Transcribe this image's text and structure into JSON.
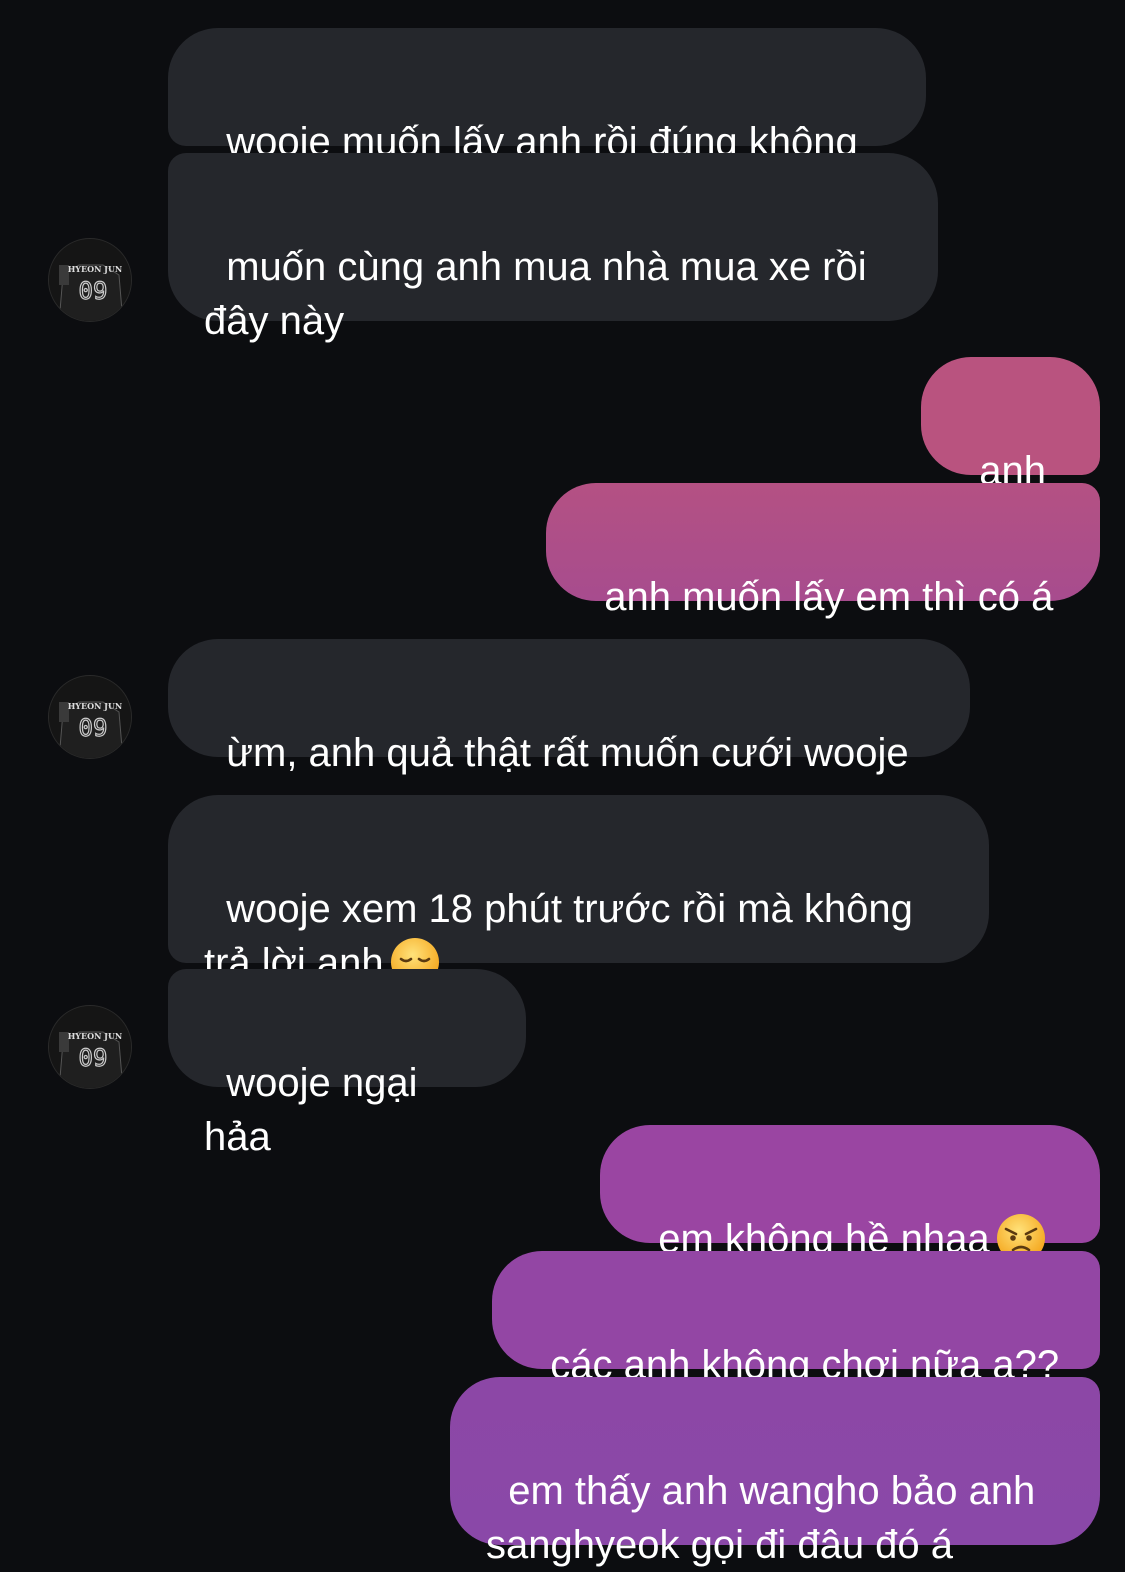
{
  "conversation": {
    "messages": [
      {
        "text": "wooje muốn lấy anh rồi đúng không"
      },
      {
        "text": "muốn cùng anh mua nhà mua xe rồi\nđây này"
      },
      {
        "text": "anh á"
      },
      {
        "text": "anh muốn lấy em thì có á"
      },
      {
        "text": "ừm, anh quả thật rất muốn cưới wooje"
      },
      {
        "text": "wooje xem 18 phút trước rồi mà không\ntrả lời anh",
        "emoji": "disappointed-face-icon"
      },
      {
        "text": "wooje ngại hảa"
      },
      {
        "text": "em không hề nhaa",
        "emoji": "angry-face-icon"
      },
      {
        "text": "các anh không chơi nữa ạ??"
      },
      {
        "text": "em thấy anh wangho bảo anh\nsanghyeok gọi đi đâu đó á"
      }
    ],
    "avatar": {
      "jersey_name": "HYEON JUN",
      "jersey_number": "09"
    },
    "colors": {
      "background": "#0c0d10",
      "incoming_bubble": "#25272c",
      "outgoing_gradient_top": "#b9537f",
      "outgoing_gradient_bottom": "#8d47a5",
      "text": "#ffffff"
    }
  }
}
